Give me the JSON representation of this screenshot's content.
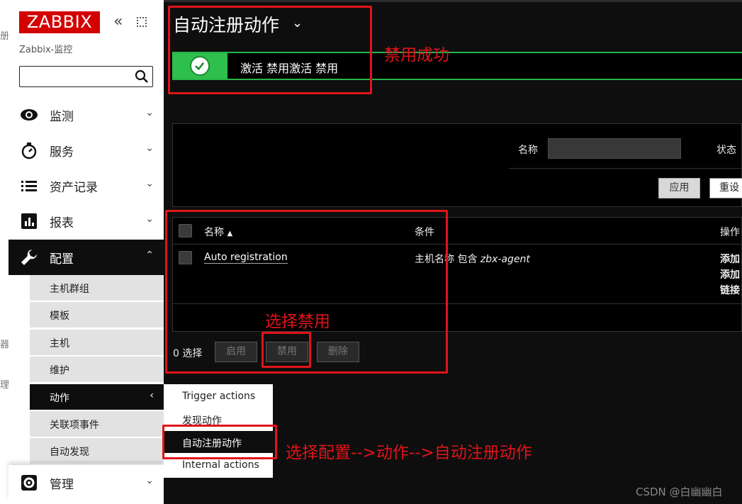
{
  "outer_strip": {
    "fragments": [
      "册",
      "器",
      "理"
    ]
  },
  "sidebar": {
    "logo": "ZABBIX",
    "server_name": "Zabbix-监控",
    "search": {
      "value": "",
      "placeholder": ""
    },
    "menu": [
      {
        "label": "监测",
        "icon": "eye-icon"
      },
      {
        "label": "服务",
        "icon": "clock-icon"
      },
      {
        "label": "资产记录",
        "icon": "list-icon"
      },
      {
        "label": "报表",
        "icon": "bar-chart-icon"
      },
      {
        "label": "配置",
        "icon": "wrench-icon"
      },
      {
        "label": "管理",
        "icon": "gear-icon"
      }
    ],
    "config_submenu": [
      "主机群组",
      "模板",
      "主机",
      "维护",
      "动作",
      "关联项事件",
      "自动发现"
    ]
  },
  "flyout": {
    "items": [
      "Trigger actions",
      "发现动作",
      "自动注册动作",
      "Internal actions"
    ]
  },
  "main": {
    "title": "自动注册动作",
    "message": "激活 禁用激活 禁用",
    "filter": {
      "name_label": "名称",
      "name_value": "",
      "status_label": "状态",
      "apply": "应用",
      "reset": "重设"
    },
    "table": {
      "headers": {
        "name": "名称",
        "conditions": "条件",
        "operations": "操作"
      },
      "rows": [
        {
          "name": "Auto registration",
          "condition_prefix": "主机名称 包含 ",
          "condition_value": "zbx-agent",
          "operations": [
            "添加",
            "添加",
            "链接"
          ]
        }
      ]
    },
    "selected": "0 选择",
    "actions": {
      "enable": "启用",
      "disable": "禁用",
      "delete": "删除"
    }
  },
  "annotations": {
    "disable_success": "禁用成功",
    "select_disable": "选择禁用",
    "navigate_hint": "选择配置-->动作-->自动注册动作"
  },
  "watermark": "CSDN @白幽幽白",
  "colors": {
    "accent_red": "#e0141a",
    "success_green": "#2fbf4d",
    "logo_red": "#d40000"
  }
}
